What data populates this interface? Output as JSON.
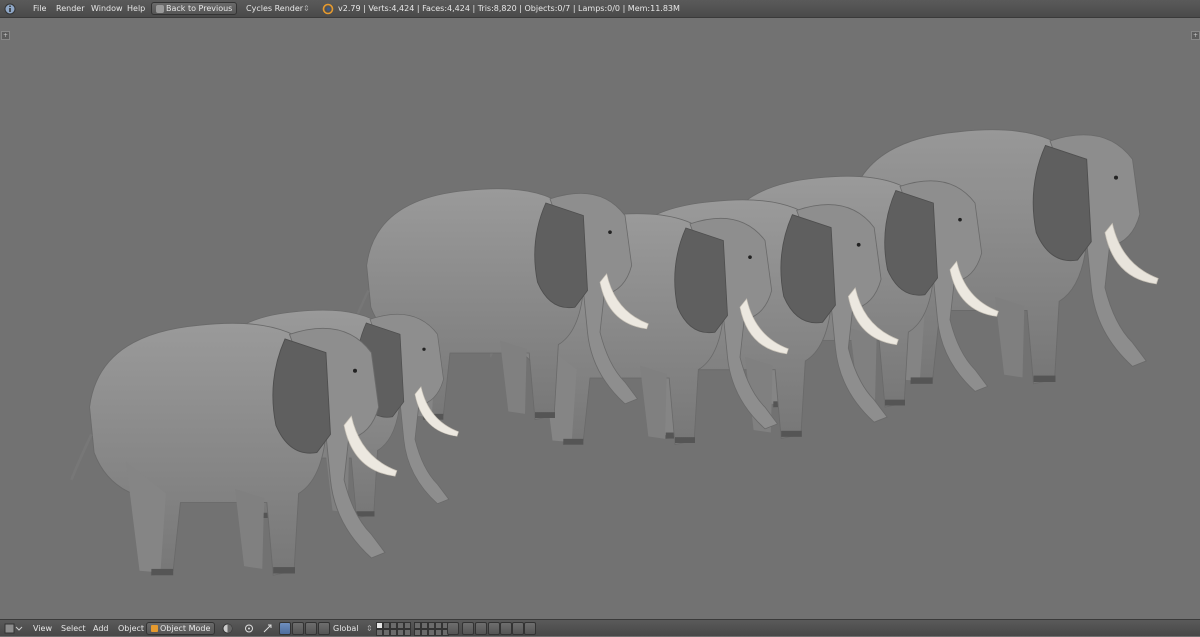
{
  "topbar": {
    "info_icon": "info-icon",
    "menus": [
      "File",
      "Render",
      "Window",
      "Help"
    ],
    "back_button": "Back to Previous",
    "engine": "Cycles Render",
    "stats": "v2.79 | Verts:4,424 | Faces:4,424 | Tris:8,820 | Objects:0/7 | Lamps:0/0 | Mem:11.83M"
  },
  "bottombar": {
    "menus": [
      "View",
      "Select",
      "Add",
      "Object"
    ],
    "mode": "Object Mode",
    "orientation": "Global"
  },
  "colors": {
    "viewport_bg": "#727272",
    "header_bg": "#4a4a4a",
    "elephant_body": "#8a8a8a",
    "elephant_dark": "#5e5e5e",
    "tusk": "#ece8e0",
    "accent_blue": "#5a7aaa"
  }
}
